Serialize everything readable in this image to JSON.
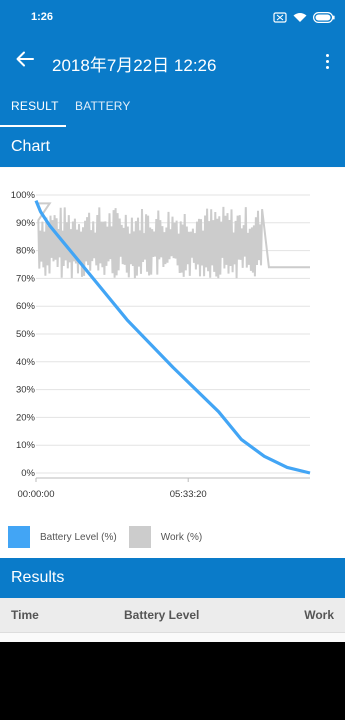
{
  "status_bar": {
    "time": "1:26",
    "icons": [
      "sim-off-icon",
      "wifi-icon",
      "battery-icon"
    ]
  },
  "app_bar": {
    "title": "2018年7月22日 12:26",
    "back_icon": "arrow-left-icon",
    "menu_icon": "more-vert-icon"
  },
  "tabs": [
    {
      "label": "RESULT",
      "active": true
    },
    {
      "label": "BATTERY",
      "active": false
    }
  ],
  "chart_section": {
    "title": "Chart"
  },
  "chart_data": {
    "type": "line",
    "y_ticks": [
      "100%",
      "90%",
      "80%",
      "70%",
      "60%",
      "50%",
      "40%",
      "30%",
      "20%",
      "10%",
      "0%"
    ],
    "x_ticks": [
      "00:00:00",
      "05:33:20"
    ],
    "ylim": [
      0,
      100
    ],
    "grid": true,
    "legend_position": "bottom-left",
    "series": [
      {
        "name": "Battery Level (%)",
        "color": "#42a5f5",
        "points": [
          [
            0,
            98
          ],
          [
            0.1,
            94
          ],
          [
            0.3,
            89
          ],
          [
            0.6,
            83
          ],
          [
            1.0,
            75
          ],
          [
            2.0,
            55
          ],
          [
            3.0,
            38
          ],
          [
            4.0,
            22
          ],
          [
            4.5,
            12
          ],
          [
            5.0,
            6
          ],
          [
            5.5,
            2
          ],
          [
            6.0,
            0
          ]
        ]
      },
      {
        "name": "Work (%)",
        "color": "#cccccc",
        "points": [
          [
            0,
            97
          ],
          [
            0.5,
            92
          ],
          [
            1.0,
            82
          ],
          [
            2.0,
            82
          ],
          [
            3.0,
            82
          ],
          [
            4.0,
            82
          ],
          [
            4.8,
            82
          ],
          [
            5.0,
            74
          ],
          [
            5.5,
            74
          ],
          [
            6.0,
            74
          ]
        ]
      }
    ]
  },
  "results_section": {
    "title": "Results"
  },
  "results_table": {
    "columns": [
      "Time",
      "Battery Level",
      "Work"
    ]
  },
  "colors": {
    "primary": "#0a7bc9",
    "battery_series": "#42a5f5",
    "work_series": "#cccccc"
  }
}
